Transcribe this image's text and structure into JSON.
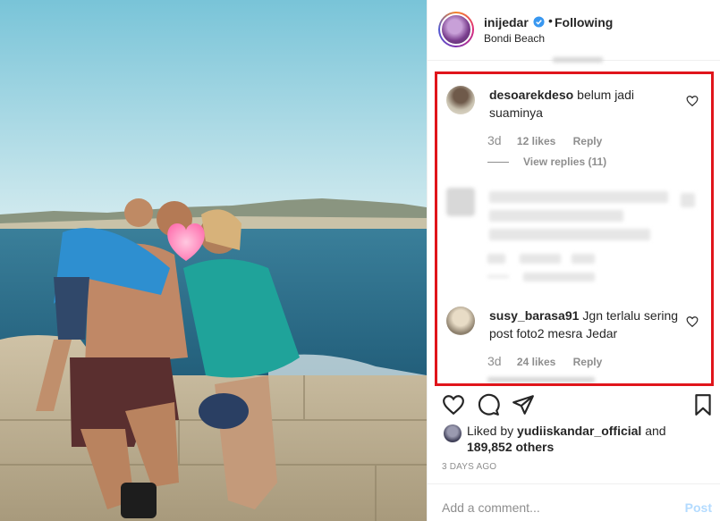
{
  "header": {
    "username": "inijedar",
    "dot": "•",
    "following_label": "Following",
    "location": "Bondi Beach"
  },
  "comments": [
    {
      "username": "desoarekdeso",
      "text": "belum jadi suaminya",
      "time": "3d",
      "likes": "12 likes",
      "reply_label": "Reply",
      "view_replies": "View replies (11)"
    },
    {
      "username": "susy_barasa91",
      "text": "Jgn terlalu sering post foto2 mesra Jedar",
      "time": "3d",
      "likes": "24 likes",
      "reply_label": "Reply"
    }
  ],
  "likes": {
    "prefix": "Liked by",
    "liker": "yudiiskandar_official",
    "conjunction": "and",
    "others": "189,852 others"
  },
  "timestamp": "3 DAYS AGO",
  "add_comment": {
    "placeholder": "Add a comment...",
    "post_label": "Post"
  },
  "colors": {
    "highlight_border": "#e0151b",
    "link_blue": "#b3dbff",
    "verified_blue": "#3897f0"
  },
  "icons": [
    "verified-badge-icon",
    "heart-icon",
    "comment-icon",
    "share-icon",
    "bookmark-icon"
  ]
}
